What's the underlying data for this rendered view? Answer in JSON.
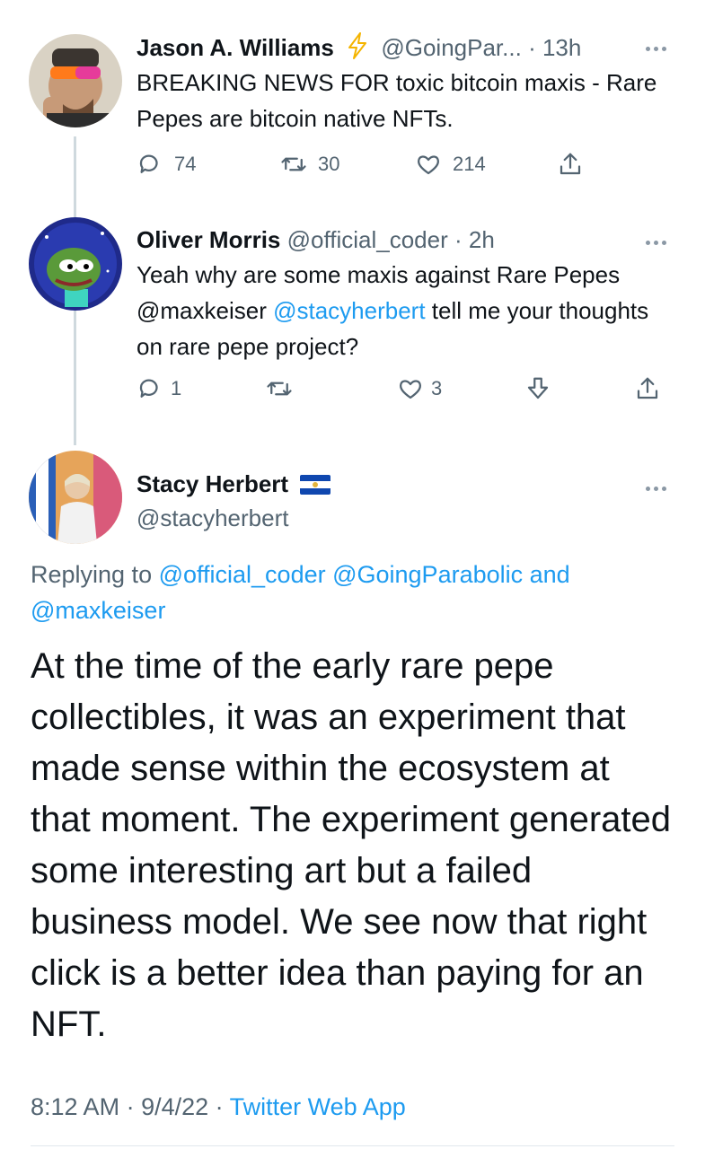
{
  "tweets": [
    {
      "name": "Jason A. Williams",
      "badge_icon": "lightning-icon",
      "handle": "@GoingPar...",
      "time": "· 13h",
      "text": "BREAKING NEWS FOR toxic bitcoin maxis - Rare Pepes are bitcoin native NFTs.",
      "replies": "74",
      "retweets": "30",
      "likes": "214"
    },
    {
      "name": "Oliver Morris",
      "handle": "@official_coder",
      "time": "· 2h",
      "text_pre": "Yeah why are some maxis against Rare Pepes @maxkeiser ",
      "mention": "@stacyherbert",
      "text_post": "  tell me your thoughts on rare pepe project?",
      "replies": "1",
      "likes": "3"
    }
  ],
  "main_tweet": {
    "name": "Stacy Herbert",
    "flag_icon": "el-salvador-flag-icon",
    "handle": "@stacyherbert",
    "replying_prefix": "Replying to ",
    "replying_mentions": "@official_coder @GoingParabolic and @maxkeiser",
    "text": "At the time of the early rare pepe collectibles, it was an experiment that made sense within the ecosystem at that moment. The experiment generated some interesting art but a failed business model. We see now that right click is a better idea than paying for an NFT.",
    "time": "8:12 AM",
    "date": "9/4/22",
    "separator": " · ",
    "source": "Twitter Web App"
  },
  "colors": {
    "link": "#1d9bf0",
    "muted": "#536471",
    "thread_line": "#cfd9de",
    "lightning": "#f4b400"
  }
}
